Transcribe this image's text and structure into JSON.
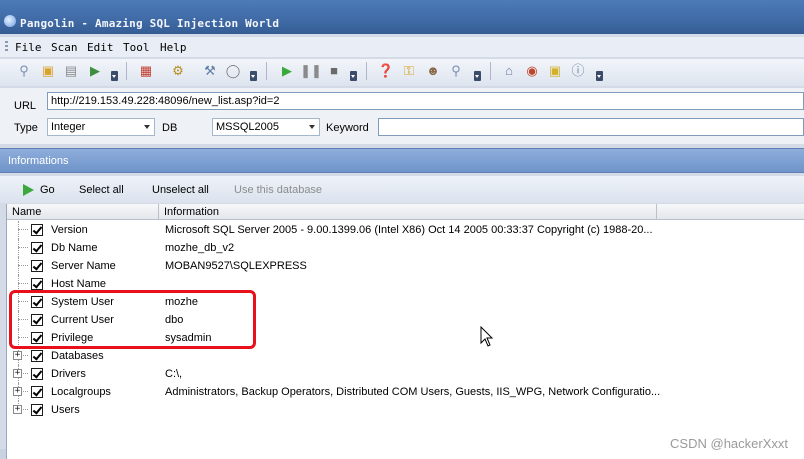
{
  "window": {
    "title": "Pangolin - Amazing SQL Injection World"
  },
  "menu": [
    "File",
    "Scan",
    "Edit",
    "Tool",
    "Help"
  ],
  "toolbar": {
    "icons": [
      "search-icon",
      "folder-icon",
      "document-icon",
      "export-icon",
      "dropdown-arrow",
      "grid-icon",
      "gear-icon",
      "wrench-icon",
      "database-icon",
      "dropdown-arrow",
      "play-icon",
      "pause-icon",
      "stop-icon",
      "dropdown-arrow",
      "help-icon",
      "key-icon",
      "user-icon",
      "magnifier-icon",
      "dropdown-arrow",
      "home-icon",
      "bug-icon",
      "box-icon",
      "info-icon",
      "dropdown-arrow"
    ]
  },
  "url_panel": {
    "url_label": "URL",
    "url_value": "http://219.153.49.228:48096/new_list.asp?id=2",
    "type_label": "Type",
    "type_value": "Integer",
    "db_label": "DB",
    "db_value": "MSSQL2005",
    "keyword_label": "Keyword",
    "keyword_value": ""
  },
  "info_panel": {
    "title": "Informations"
  },
  "actions": {
    "go": "Go",
    "select_all": "Select all",
    "unselect_all": "Unselect all",
    "use_db": "Use this database"
  },
  "grid": {
    "columns": [
      "Name",
      "Information"
    ],
    "rows": [
      {
        "name": "Version",
        "info": "Microsoft SQL Server 2005 - 9.00.1399.06 (Intel X86) Oct 14 2005 00:33:37 Copyright (c) 1988-20...",
        "expandable": false
      },
      {
        "name": "Db Name",
        "info": "mozhe_db_v2",
        "expandable": false
      },
      {
        "name": "Server Name",
        "info": "MOBAN9527\\SQLEXPRESS",
        "expandable": false
      },
      {
        "name": "Host Name",
        "info": "",
        "expandable": false
      },
      {
        "name": "System User",
        "info": "mozhe",
        "expandable": false
      },
      {
        "name": "Current User",
        "info": "dbo",
        "expandable": false
      },
      {
        "name": "Privilege",
        "info": "sysadmin",
        "expandable": false
      },
      {
        "name": "Databases",
        "info": "",
        "expandable": true
      },
      {
        "name": "Drivers",
        "info": "C:\\,",
        "expandable": true
      },
      {
        "name": "Localgroups",
        "info": "Administrators, Backup Operators, Distributed COM Users, Guests, IIS_WPG, Network Configuratio...",
        "expandable": true
      },
      {
        "name": "Users",
        "info": "",
        "expandable": true
      }
    ]
  },
  "watermark": "CSDN @hackerXxxt",
  "colors": {
    "highlight": "#e8101b",
    "titlebar": "#3f6aa6",
    "infobar": "#7a9dd0"
  }
}
